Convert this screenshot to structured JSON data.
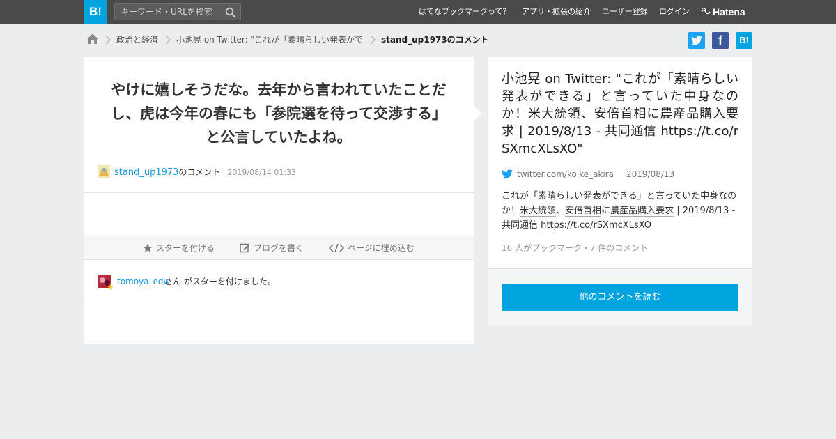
{
  "header": {
    "logo": "B!",
    "search_placeholder": "キーワード・URLを検索",
    "nav": [
      "はてなブックマークって？",
      "アプリ・拡張の紹介",
      "ユーザー登録",
      "ログイン"
    ],
    "brand": "Hatena"
  },
  "breadcrumb": {
    "items": [
      "政治と経済",
      "小池晃 on Twitter: \"これが「素晴らしい発表がで...",
      "stand_up1973のコメント"
    ]
  },
  "share": {
    "twitter": "twitter",
    "facebook": "f",
    "hatena": "B!"
  },
  "comment": {
    "text": "やけに嬉しそうだな。去年から言われていたことだし、虎は今年の春にも「参院選を待って交渉する」と公言していたよね。",
    "user": "stand_up1973",
    "user_suffix": "のコメント",
    "date": "2019/08/14 01:33"
  },
  "actions": {
    "star": "スターを付ける",
    "blog": "ブログを書く",
    "embed": "ページに埋め込む"
  },
  "star_activity": {
    "user": "tomoya_edw",
    "text": "さん がスターを付けました。"
  },
  "entry": {
    "title": "小池晃 on Twitter: \"これが「素晴らしい発表ができる」と言っていた中身なのか！米大統領、安倍首相に農産品購入要求 | 2019/8/13 - 共同通信 https://t.co/rSXmcXLsXO\"",
    "source": "twitter.com/koike_akira",
    "date": "2019/08/13",
    "desc_before": "これが「素晴らしい発表ができる」と言っていた中身なのか！",
    "desc_link1": "米大統領",
    "desc_sep1": "、",
    "desc_link2": "安倍首相",
    "desc_sep2": "に",
    "desc_link3": "農産品購入要求",
    "desc_mid": " | 2019/8/13 - ",
    "desc_link4": "共同通信",
    "desc_after": " https://t.co/rSXmcXLsXO",
    "count": "16 人がブックマーク・7 件のコメント",
    "read_more": "他のコメントを読む"
  },
  "colors": {
    "topbar": "#4a4a4a",
    "accent": "#00a4de",
    "link": "#1a9bd7",
    "twitter": "#1da1f2",
    "facebook": "#3b5998"
  }
}
